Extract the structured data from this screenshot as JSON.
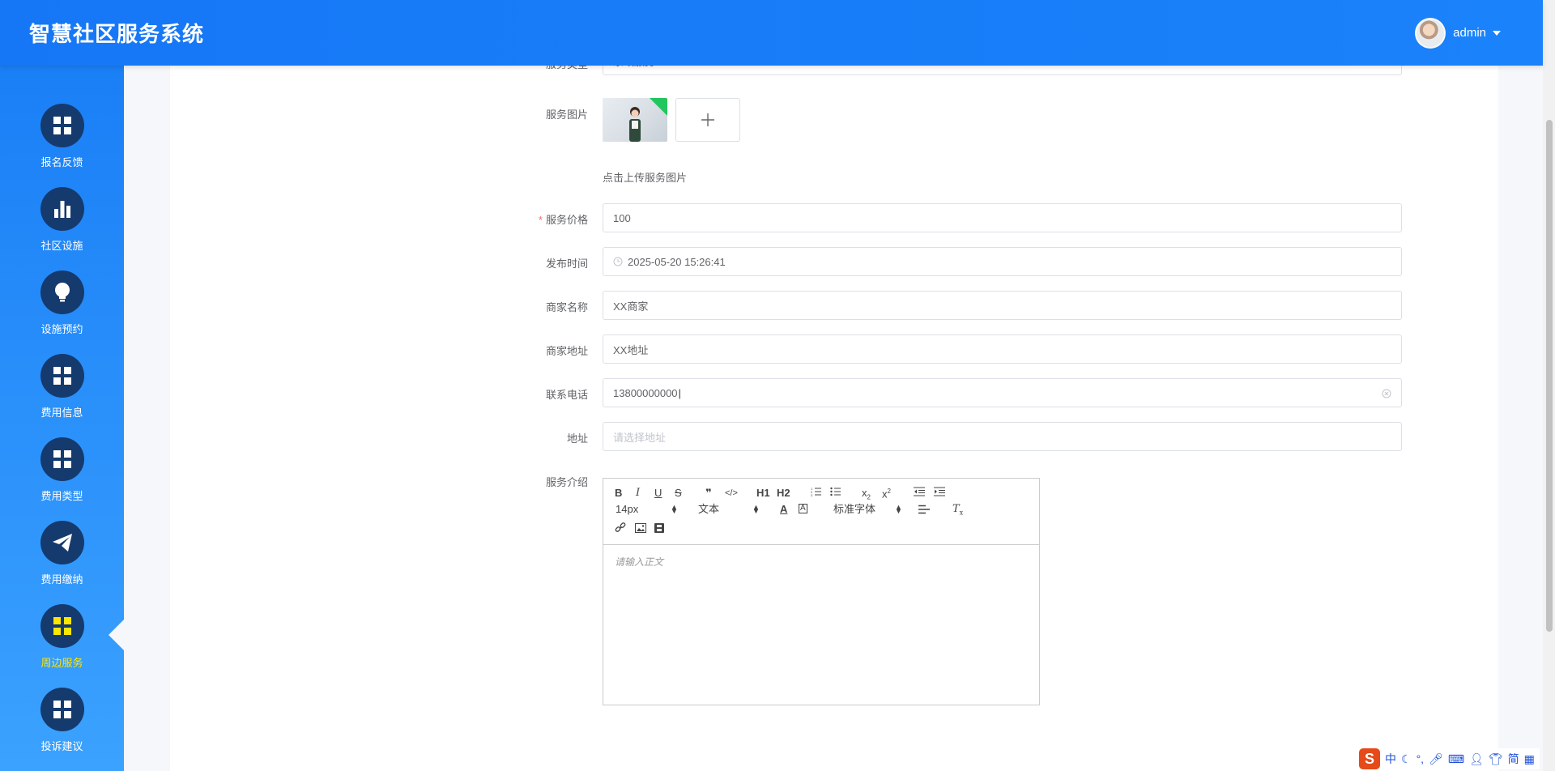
{
  "header": {
    "title": "智慧社区服务系统",
    "username": "admin"
  },
  "sidebar": {
    "items": [
      {
        "label": "报名反馈",
        "icon": "grid-icon"
      },
      {
        "label": "社区设施",
        "icon": "bar-chart-icon"
      },
      {
        "label": "设施预约",
        "icon": "lightbulb-icon"
      },
      {
        "label": "费用信息",
        "icon": "grid-icon"
      },
      {
        "label": "费用类型",
        "icon": "grid-icon"
      },
      {
        "label": "费用缴纳",
        "icon": "paper-plane-icon"
      },
      {
        "label": "周边服务",
        "icon": "grid-icon",
        "active": true
      },
      {
        "label": "投诉建议",
        "icon": "grid-icon"
      }
    ],
    "active_color": "#ffe600"
  },
  "form": {
    "service_type": {
      "label": "服务类型",
      "value": "家政服务"
    },
    "service_image": {
      "label": "服务图片",
      "hint": "点击上传服务图片"
    },
    "service_price": {
      "label": "服务价格",
      "value": "100"
    },
    "publish_time": {
      "label": "发布时间",
      "value": "2025-05-20 15:26:41"
    },
    "merchant_name": {
      "label": "商家名称",
      "value": "XX商家"
    },
    "merchant_address": {
      "label": "商家地址",
      "value": "XX地址"
    },
    "phone": {
      "label": "联系电话",
      "value": "13800000000"
    },
    "address": {
      "label": "地址",
      "placeholder": "请选择地址"
    },
    "service_intro": {
      "label": "服务介绍"
    }
  },
  "editor": {
    "font_size": "14px",
    "paragraph": "文本",
    "font_family": "标准字体",
    "placeholder": "请输入正文",
    "h1": "H1",
    "h2": "H2"
  },
  "ime": {
    "items": [
      "中",
      "简"
    ]
  },
  "colors": {
    "header": "#1677f6",
    "sidebar_top": "#1a7ff6",
    "sidebar_bottom": "#3ba2ff",
    "nav_circle": "#153a6e",
    "required": "#f56c6c"
  }
}
